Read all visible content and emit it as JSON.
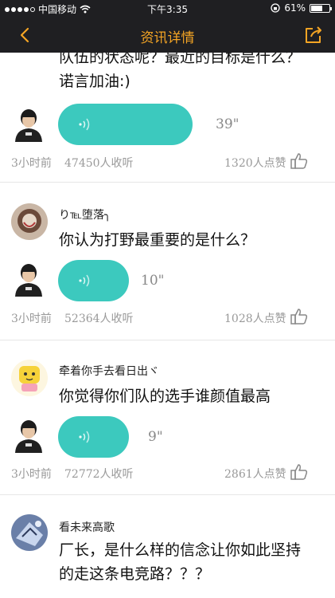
{
  "status_bar": {
    "carrier": "中国移动",
    "time": "下午3:35",
    "battery": "61%",
    "battery_level": 0.61
  },
  "nav": {
    "title": "资讯详情",
    "back_icon": "chevron-left-icon",
    "share_icon": "share-icon"
  },
  "colors": {
    "nav_bg": "#1f1f22",
    "accent": "#f5a524",
    "bubble": "#3cc9be"
  },
  "items": [
    {
      "question_lines": [
        "队伍的状态呢？最近的目标是什么？",
        "诺言加油:)"
      ],
      "duration": "39\"",
      "time_ago": "3小时前",
      "listens": "47450人收听",
      "likes": "1320人点赞"
    },
    {
      "username": "り℡堕落╮",
      "question": "你认为打野最重要的是什么？",
      "duration": "10\"",
      "time_ago": "3小时前",
      "listens": "52364人收听",
      "likes": "1028人点赞"
    },
    {
      "username": "牵着你手去看日出ヾ",
      "question": "你觉得你们队的选手谁颜值最高",
      "duration": "9\"",
      "time_ago": "3小时前",
      "listens": "72772人收听",
      "likes": "2861人点赞"
    },
    {
      "username": "看未来高歌",
      "question_lines": [
        "厂长，是什么样的信念让你如此坚持",
        "的走这条电竞路？？？"
      ]
    }
  ]
}
